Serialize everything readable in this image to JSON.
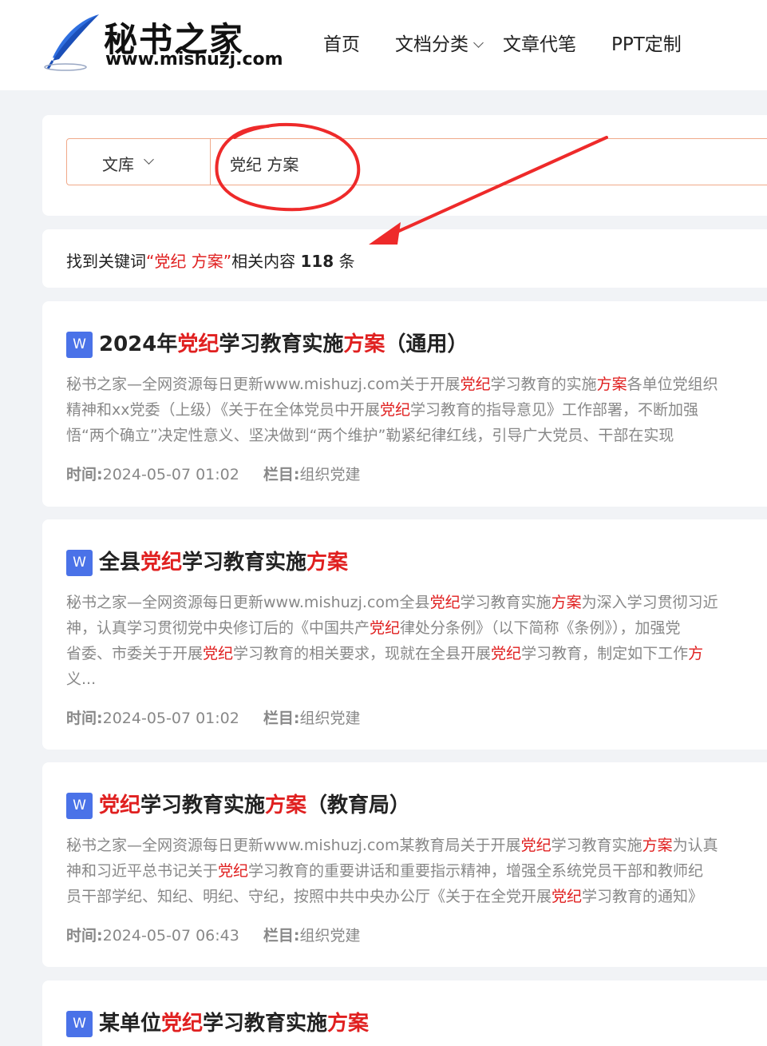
{
  "header": {
    "logo_cn": "秘书之家",
    "logo_en": "www.mishuzj.com",
    "logo_icon": "feather-pen-icon",
    "nav": [
      {
        "label": "首页"
      },
      {
        "label": "文档分类",
        "has_dropdown": true
      },
      {
        "label": "文章代笔"
      },
      {
        "label": "PPT定制"
      }
    ]
  },
  "search": {
    "type_label": "文库",
    "query": "党纪  方案"
  },
  "summary": {
    "prefix": "找到关键词",
    "keyword": "“党纪 方案”",
    "middle": "相关内容",
    "count": "118",
    "suffix": "条"
  },
  "results": [
    {
      "icon": "W",
      "title_parts": [
        [
          "2024年",
          false
        ],
        [
          "党纪",
          true
        ],
        [
          "学习教育实施",
          false
        ],
        [
          "方案",
          true
        ],
        [
          "（通用）",
          false
        ]
      ],
      "desc_lines": [
        [
          [
            "秘书之家—全网资源每日更新www.mishuzj.com关于开展",
            false
          ],
          [
            "党纪",
            true
          ],
          [
            "学习教育的实施",
            false
          ],
          [
            "方案",
            true
          ],
          [
            "各单位党组织",
            false
          ]
        ],
        [
          [
            "精神和xx党委（上级）《关于在全体党员中开展",
            false
          ],
          [
            "党纪",
            true
          ],
          [
            "学习教育的指导意见》工作部署，不断加强",
            false
          ]
        ],
        [
          [
            "悟“两个确立”决定性意义、坚决做到“两个维护”勒紧纪律红线，引导广大党员、干部在实现",
            false
          ]
        ]
      ],
      "time_label": "时间:",
      "time": "2024-05-07 01:02",
      "column_label": "栏目:",
      "column": "组织党建"
    },
    {
      "icon": "W",
      "title_parts": [
        [
          "全县",
          false
        ],
        [
          "党纪",
          true
        ],
        [
          "学习教育实施",
          false
        ],
        [
          "方案",
          true
        ]
      ],
      "desc_lines": [
        [
          [
            "秘书之家—全网资源每日更新www.mishuzj.com全县",
            false
          ],
          [
            "党纪",
            true
          ],
          [
            "学习教育实施",
            false
          ],
          [
            "方案",
            true
          ],
          [
            "为深入学习贯彻习近",
            false
          ]
        ],
        [
          [
            "神，认真学习贯彻党中央修订后的《中国共产",
            false
          ],
          [
            "党纪",
            true
          ],
          [
            "律处分条例》（以下简称《条例》），加强党",
            false
          ]
        ],
        [
          [
            "省委、市委关于开展",
            false
          ],
          [
            "党纪",
            true
          ],
          [
            "学习教育的相关要求，现就在全县开展",
            false
          ],
          [
            "党纪",
            true
          ],
          [
            "学习教育，制定如下工作",
            false
          ],
          [
            "方",
            true
          ]
        ],
        [
          [
            "义...",
            false
          ]
        ]
      ],
      "time_label": "时间:",
      "time": "2024-05-07 01:02",
      "column_label": "栏目:",
      "column": "组织党建"
    },
    {
      "icon": "W",
      "title_parts": [
        [
          "党纪",
          true
        ],
        [
          "学习教育实施",
          false
        ],
        [
          "方案",
          true
        ],
        [
          "（教育局）",
          false
        ]
      ],
      "desc_lines": [
        [
          [
            "秘书之家—全网资源每日更新www.mishuzj.com某教育局关于开展",
            false
          ],
          [
            "党纪",
            true
          ],
          [
            "学习教育实施",
            false
          ],
          [
            "方案",
            true
          ],
          [
            "为认真",
            false
          ]
        ],
        [
          [
            "神和习近平总书记关于",
            false
          ],
          [
            "党纪",
            true
          ],
          [
            "学习教育的重要讲话和重要指示精神，增强全系统党员干部和教师纪",
            false
          ]
        ],
        [
          [
            "员干部学纪、知纪、明纪、守纪，按照中共中央办公厅《关于在全党开展",
            false
          ],
          [
            "党纪",
            true
          ],
          [
            "学习教育的通知》",
            false
          ]
        ]
      ],
      "time_label": "时间:",
      "time": "2024-05-07 06:43",
      "column_label": "栏目:",
      "column": "组织党建"
    },
    {
      "icon": "W",
      "title_parts": [
        [
          "某单位",
          false
        ],
        [
          "党纪",
          true
        ],
        [
          "学习教育实施",
          false
        ],
        [
          "方案",
          true
        ]
      ],
      "desc_lines": [],
      "time_label": "",
      "time": "",
      "column_label": "",
      "column": ""
    }
  ],
  "colors": {
    "highlight": "#e02020",
    "annotation": "#ee2a2a",
    "word_icon": "#4a72e8",
    "search_border": "#f0a98a"
  }
}
